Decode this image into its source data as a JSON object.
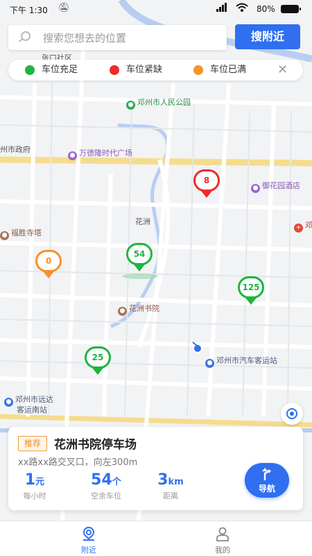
{
  "status_bar": {
    "time": "下午 1:30",
    "battery": "80%"
  },
  "search": {
    "placeholder": "搜索您想去的位置",
    "button": "搜附近"
  },
  "legend": {
    "items": [
      {
        "label": "车位充足",
        "color": "#1db540"
      },
      {
        "label": "车位紧缺",
        "color": "#ef2b2b"
      },
      {
        "label": "车位已满",
        "color": "#f5922a"
      }
    ],
    "close_icon": "close-icon"
  },
  "map": {
    "pois": [
      {
        "label": "张口社区"
      },
      {
        "label": "邓州市人民公园"
      },
      {
        "label": "州市政府"
      },
      {
        "label": "万德隆时代广场"
      },
      {
        "label": "御花园酒店"
      },
      {
        "label": "花洲"
      },
      {
        "label": "福胜寺塔"
      },
      {
        "label": "花洲书院"
      },
      {
        "label": "邓州市汽车客运站"
      },
      {
        "label": "邓州市远达"
      },
      {
        "label": "客运南站"
      },
      {
        "label": "邓"
      }
    ],
    "pins": [
      {
        "count": "8",
        "status": "short",
        "color": "#ef2b2b"
      },
      {
        "count": "54",
        "status": "ample",
        "color": "#1db540"
      },
      {
        "count": "0",
        "status": "full",
        "color": "#f5922a"
      },
      {
        "count": "125",
        "status": "ample",
        "color": "#1db540"
      },
      {
        "count": "25",
        "status": "ample",
        "color": "#1db540"
      }
    ]
  },
  "card": {
    "tag": "推荐",
    "name": "花洲书院停车场",
    "address": "xx路xx路交叉口，向左300m",
    "price_value": "1",
    "price_unit": "元",
    "price_caption": "每小时",
    "spaces_value": "54",
    "spaces_unit": "个",
    "spaces_caption": "空余车位",
    "distance_value": "3",
    "distance_unit": "km",
    "distance_caption": "距离",
    "nav_label": "导航"
  },
  "tabbar": {
    "tabs": [
      {
        "label": "附近",
        "active": true
      },
      {
        "label": "我的",
        "active": false
      }
    ]
  },
  "colors": {
    "accent": "#2f6ff0"
  }
}
